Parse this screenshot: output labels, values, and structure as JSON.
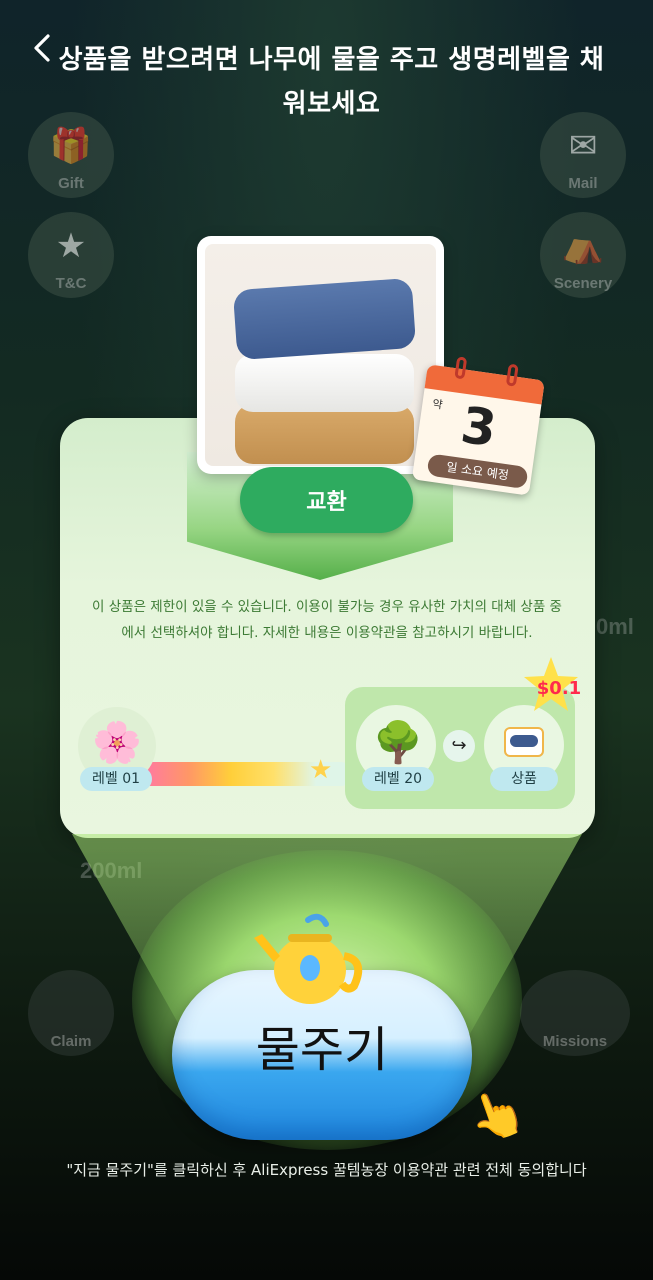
{
  "header": {
    "title": "상품을 받으려면 나무에 물을 주고 생명레벨을 채워보세요",
    "back_icon": "chevron-left-icon"
  },
  "background": {
    "icons": [
      {
        "label": "Gift",
        "icon": "gift-icon"
      },
      {
        "label": "Mail",
        "icon": "mail-icon"
      },
      {
        "label": "T&C",
        "icon": "terms-icon"
      },
      {
        "label": "Scenery",
        "icon": "scenery-icon"
      },
      {
        "label": "Claim",
        "icon": "claim-icon"
      },
      {
        "label": "Missions",
        "icon": "missions-icon"
      }
    ],
    "water_amount_left": "200ml",
    "water_amount_right": "0ml"
  },
  "product": {
    "image_icon": "towels-image",
    "exchange_label": "교환",
    "calendar": {
      "approx_label": "약",
      "days": "3",
      "days_label": "일 소요 예정"
    },
    "notice": "이 상품은 제한이 있을 수 있습니다. 이용이 불가능 경우 유사한 가치의 대체 상품 중에서 선택하셔야 합니다. 자세한 내용은 이용약관을 참고하시기 바랍니다."
  },
  "progress": {
    "current_level_label": "레벨 01",
    "target_level_label": "레벨 20",
    "product_label": "상품",
    "price_badge": "$0.1",
    "fill_percent": 85
  },
  "water_button": {
    "label": "물주기"
  },
  "terms": {
    "text": "\"지금 물주기\"를 클릭하신 후 AliExpress 꿀템농장 이용약관 관련 전체 동의합니다"
  },
  "colors": {
    "accent_green": "#2eab5f",
    "card_bg": "#e6f5dc",
    "water_blue": "#1f86de"
  }
}
